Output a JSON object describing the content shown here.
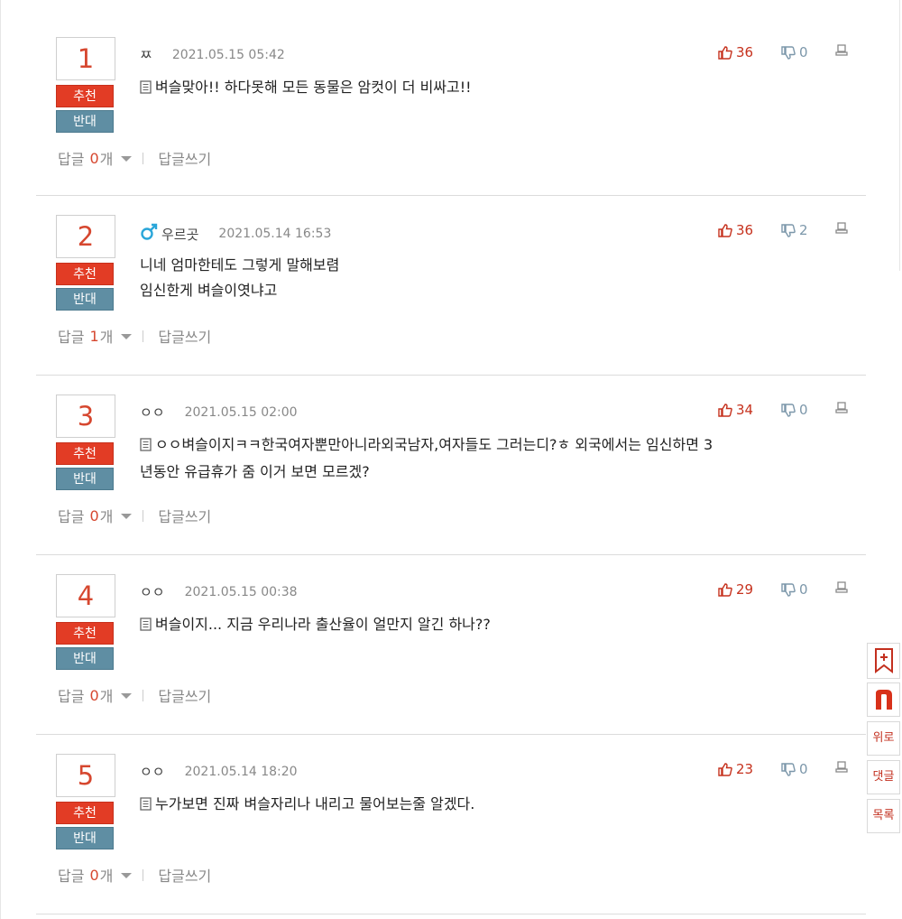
{
  "vote_labels": {
    "up": "추천",
    "down": "반대"
  },
  "reply_labels": {
    "prefix": "답글",
    "suffix": "개",
    "write": "답글쓰기"
  },
  "comments": [
    {
      "rank": "1",
      "author": "ㅉ",
      "gender_icon": "",
      "date": "2021.05.15 05:42",
      "likes": "36",
      "dislikes": "0",
      "has_memo_icon": true,
      "lines": [
        "벼슬맞아!! 하다못해 모든 동물은 암컷이 더 비싸고!!"
      ],
      "reply_count": "0"
    },
    {
      "rank": "2",
      "author": "우르곳",
      "gender_icon": "male-icon",
      "date": "2021.05.14 16:53",
      "likes": "36",
      "dislikes": "2",
      "has_memo_icon": false,
      "lines": [
        "니네 엄마한테도 그렇게 말해보렴",
        "임신한게 벼슬이엿냐고"
      ],
      "reply_count": "1"
    },
    {
      "rank": "3",
      "author": "ㅇㅇ",
      "gender_icon": "",
      "date": "2021.05.15 02:00",
      "likes": "34",
      "dislikes": "0",
      "has_memo_icon": true,
      "lines": [
        "ㅇㅇ벼슬이지ㅋㅋ한국여자뿐만아니라외국남자,여자들도 그러는디?ㅎ 외국에서는 임신하면 3",
        "년동안 유급휴가 줌 이거 보면 모르겠?"
      ],
      "reply_count": "0"
    },
    {
      "rank": "4",
      "author": "ㅇㅇ",
      "gender_icon": "",
      "date": "2021.05.15 00:38",
      "likes": "29",
      "dislikes": "0",
      "has_memo_icon": true,
      "lines": [
        "벼슬이지... 지금 우리나라 출산율이 얼만지 알긴 하나??"
      ],
      "reply_count": "0"
    },
    {
      "rank": "5",
      "author": "ㅇㅇ",
      "gender_icon": "",
      "date": "2021.05.14 18:20",
      "likes": "23",
      "dislikes": "0",
      "has_memo_icon": true,
      "lines": [
        "누가보면 진짜 벼슬자리나 내리고 물어보는줄 알겠다."
      ],
      "reply_count": "0"
    }
  ],
  "side_buttons": {
    "top": "위로",
    "comments": "댓글",
    "list": "목록"
  },
  "colors": {
    "accent_red": "#e23c25",
    "down_blue": "#5f8ea3",
    "rank_red": "#d6472f"
  }
}
